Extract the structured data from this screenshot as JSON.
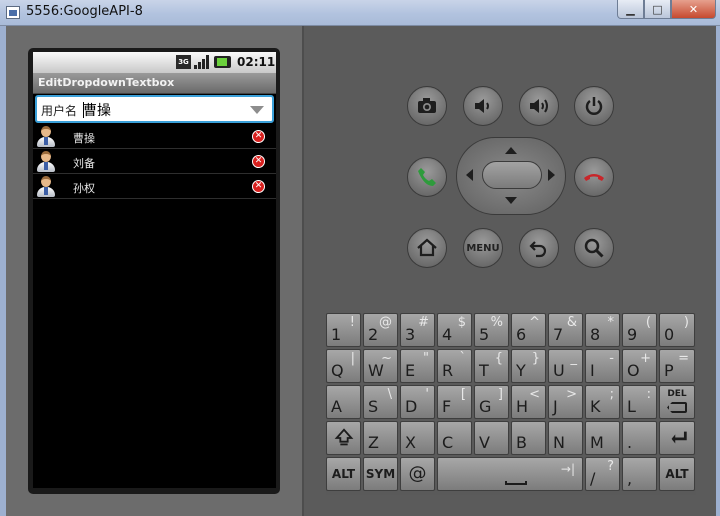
{
  "window": {
    "title": "5556:GoogleAPI-8"
  },
  "statusbar": {
    "network": "3G",
    "time": "02:11"
  },
  "app": {
    "title": "EditDropdownTextbox"
  },
  "input": {
    "label": "用户名",
    "value": "曹操"
  },
  "list": {
    "items": [
      {
        "name": "曹操"
      },
      {
        "name": "刘备"
      },
      {
        "name": "孙权"
      }
    ]
  },
  "controls": {
    "menu_label": "MENU"
  },
  "keyboard": {
    "row1": [
      {
        "main": "1",
        "alt": "!"
      },
      {
        "main": "2",
        "alt": "@"
      },
      {
        "main": "3",
        "alt": "#"
      },
      {
        "main": "4",
        "alt": "$"
      },
      {
        "main": "5",
        "alt": "%"
      },
      {
        "main": "6",
        "alt": "^"
      },
      {
        "main": "7",
        "alt": "&"
      },
      {
        "main": "8",
        "alt": "*"
      },
      {
        "main": "9",
        "alt": "("
      },
      {
        "main": "0",
        "alt": ")"
      }
    ],
    "row2": [
      {
        "main": "Q",
        "alt": "|"
      },
      {
        "main": "W",
        "alt": "~"
      },
      {
        "main": "E",
        "alt": "\""
      },
      {
        "main": "R",
        "alt": "`"
      },
      {
        "main": "T",
        "alt": "{"
      },
      {
        "main": "Y",
        "alt": "}"
      },
      {
        "main": "U",
        "alt": "_"
      },
      {
        "main": "I",
        "alt": "-"
      },
      {
        "main": "O",
        "alt": "+"
      },
      {
        "main": "P",
        "alt": "="
      }
    ],
    "row3": [
      {
        "main": "A",
        "alt": ""
      },
      {
        "main": "S",
        "alt": "\\"
      },
      {
        "main": "D",
        "alt": "'"
      },
      {
        "main": "F",
        "alt": "["
      },
      {
        "main": "G",
        "alt": "]"
      },
      {
        "main": "H",
        "alt": "<"
      },
      {
        "main": "J",
        "alt": ">"
      },
      {
        "main": "K",
        "alt": ";"
      },
      {
        "main": "L",
        "alt": ":"
      }
    ],
    "del_label": "DEL",
    "row4": [
      {
        "main": "Z",
        "alt": ""
      },
      {
        "main": "X",
        "alt": ""
      },
      {
        "main": "C",
        "alt": ""
      },
      {
        "main": "V",
        "alt": ""
      },
      {
        "main": "B",
        "alt": ""
      },
      {
        "main": "N",
        "alt": ""
      },
      {
        "main": "M",
        "alt": ""
      },
      {
        "main": ".",
        "alt": ""
      }
    ],
    "alt_label": "ALT",
    "sym_label": "SYM",
    "at_label": "@",
    "slash": {
      "main": "/",
      "alt": "?"
    },
    "comma": ","
  },
  "colors": {
    "input_focus": "#3aa0d9",
    "delete_red": "#d8201e",
    "call_green": "#2e9b3c",
    "end_red": "#c8262a"
  }
}
